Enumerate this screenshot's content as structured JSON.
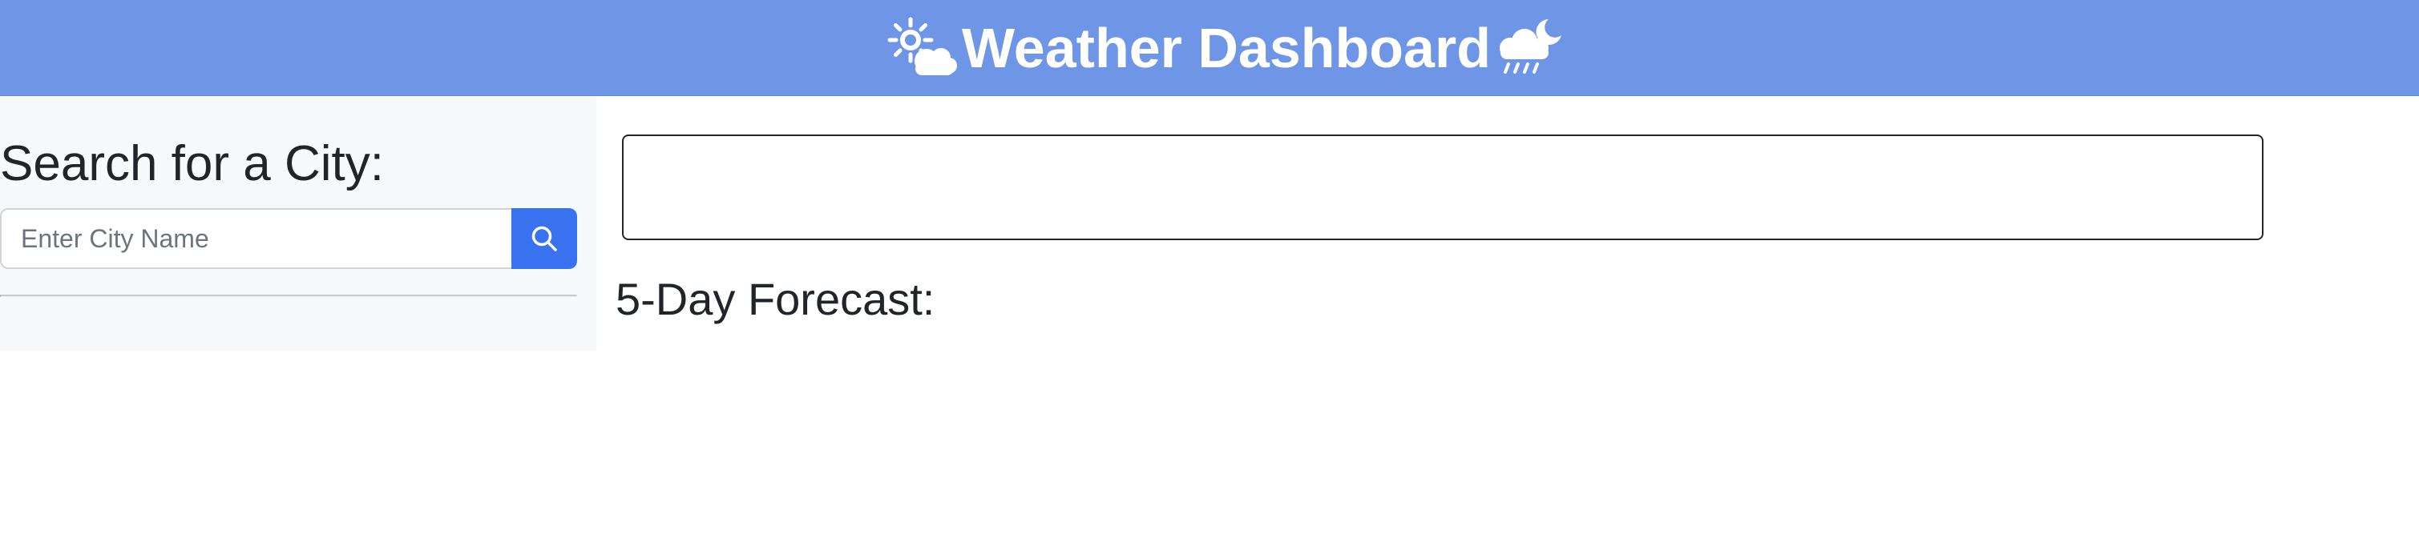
{
  "header": {
    "title": "Weather Dashboard",
    "left_icon": "sun-behind-cloud-icon",
    "right_icon": "cloud-rain-moon-icon",
    "background_color": "#6f96e6",
    "text_color": "#ffffff"
  },
  "sidebar": {
    "heading": "Search for a City:",
    "search": {
      "placeholder": "Enter City Name",
      "value": "",
      "button_icon": "search-icon",
      "button_color": "#3a73ef"
    },
    "history": []
  },
  "main": {
    "current_weather": {
      "content": ""
    },
    "forecast": {
      "heading": "5-Day Forecast:",
      "days": []
    }
  }
}
